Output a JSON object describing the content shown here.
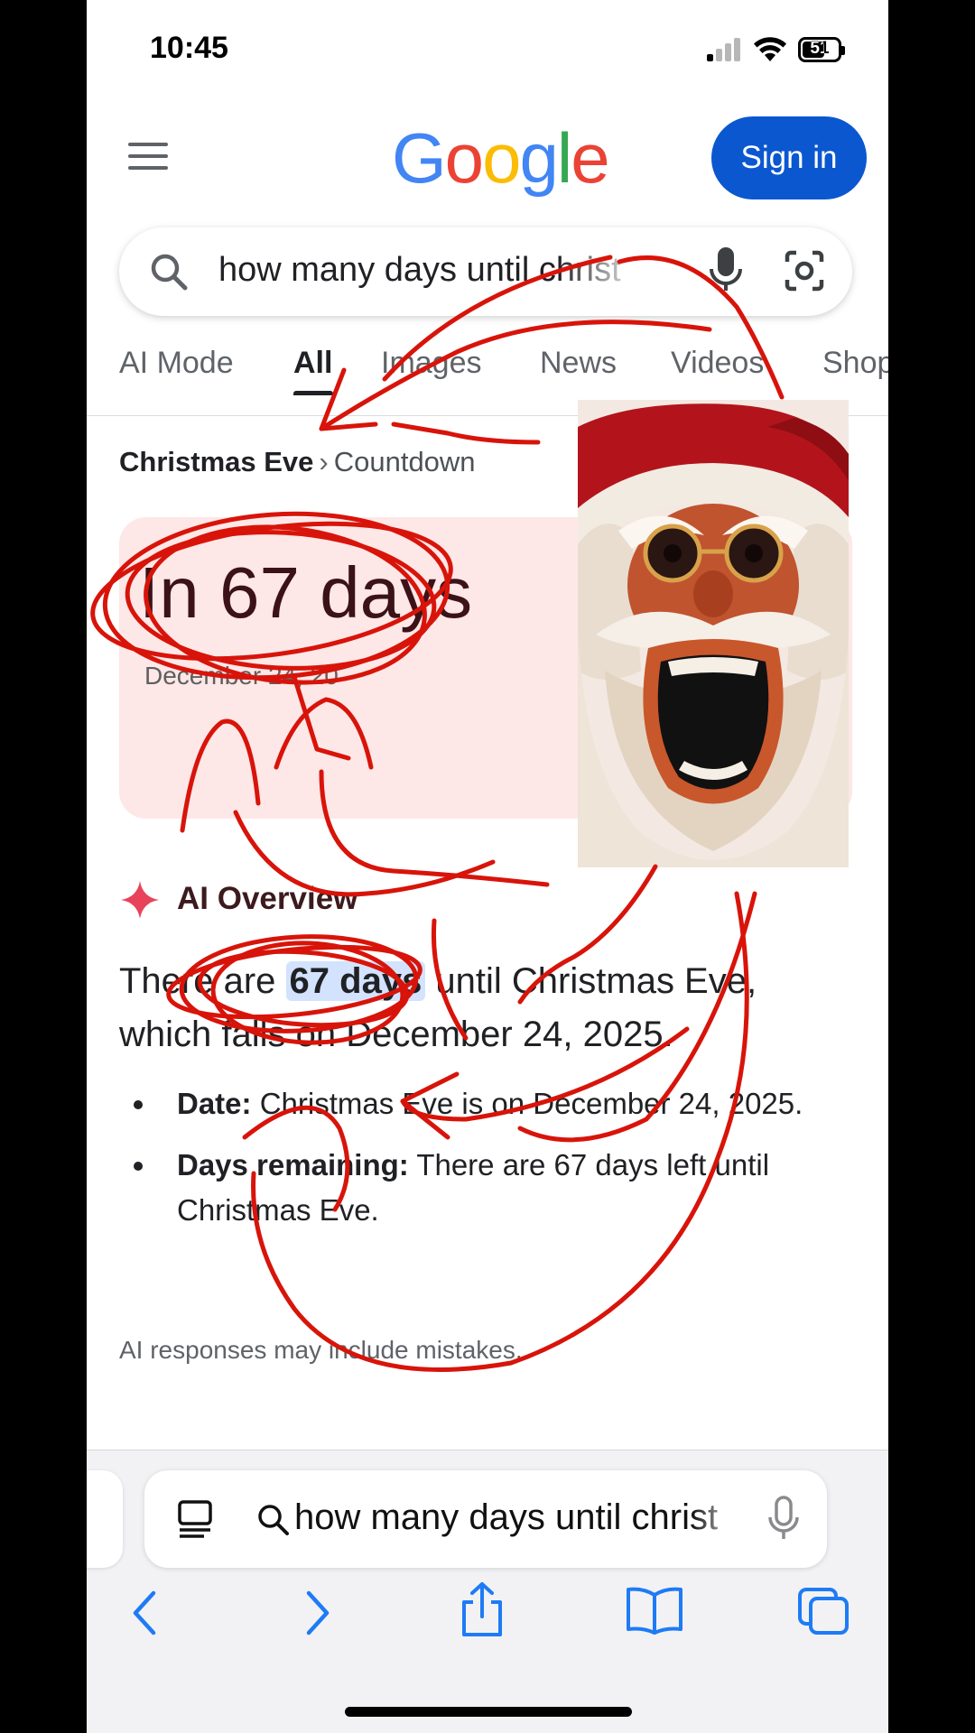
{
  "status_bar": {
    "time": "10:45",
    "battery": "51"
  },
  "header": {
    "logo_letters": [
      {
        "char": "G",
        "color": "#4285F4"
      },
      {
        "char": "o",
        "color": "#EA4335"
      },
      {
        "char": "o",
        "color": "#FBBC05"
      },
      {
        "char": "g",
        "color": "#4285F4"
      },
      {
        "char": "l",
        "color": "#34A853"
      },
      {
        "char": "e",
        "color": "#EA4335"
      }
    ],
    "sign_in_label": "Sign in"
  },
  "search": {
    "query": "how many days until christ"
  },
  "tabs": [
    "AI Mode",
    "All",
    "Images",
    "News",
    "Videos",
    "Shop"
  ],
  "active_tab": "All",
  "breadcrumb": {
    "primary": "Christmas Eve",
    "separator": "›",
    "secondary": "Countdown"
  },
  "countdown": {
    "value": "In 67 days",
    "date": "December 24, 20"
  },
  "ai_overview": {
    "title": "AI Overview",
    "answer_before": "There are ",
    "answer_highlight": "67 days",
    "answer_after": " until Christmas Eve, which falls on December 24, 2025.",
    "bullets": [
      {
        "label": "Date:",
        "text": " Christmas Eve is on December 24, 2025."
      },
      {
        "label": "Days remaining:",
        "text": " There are 67 days left until Christmas Eve."
      }
    ],
    "disclaimer": "AI responses may include mistakes."
  },
  "safari": {
    "address_text": "how many days until christ"
  },
  "colors": {
    "accent_blue": "#0B57D0",
    "scribble_red": "#D8140A",
    "countdown_card_bg": "#FDE7E7",
    "ai_spark": "#E8435A"
  }
}
